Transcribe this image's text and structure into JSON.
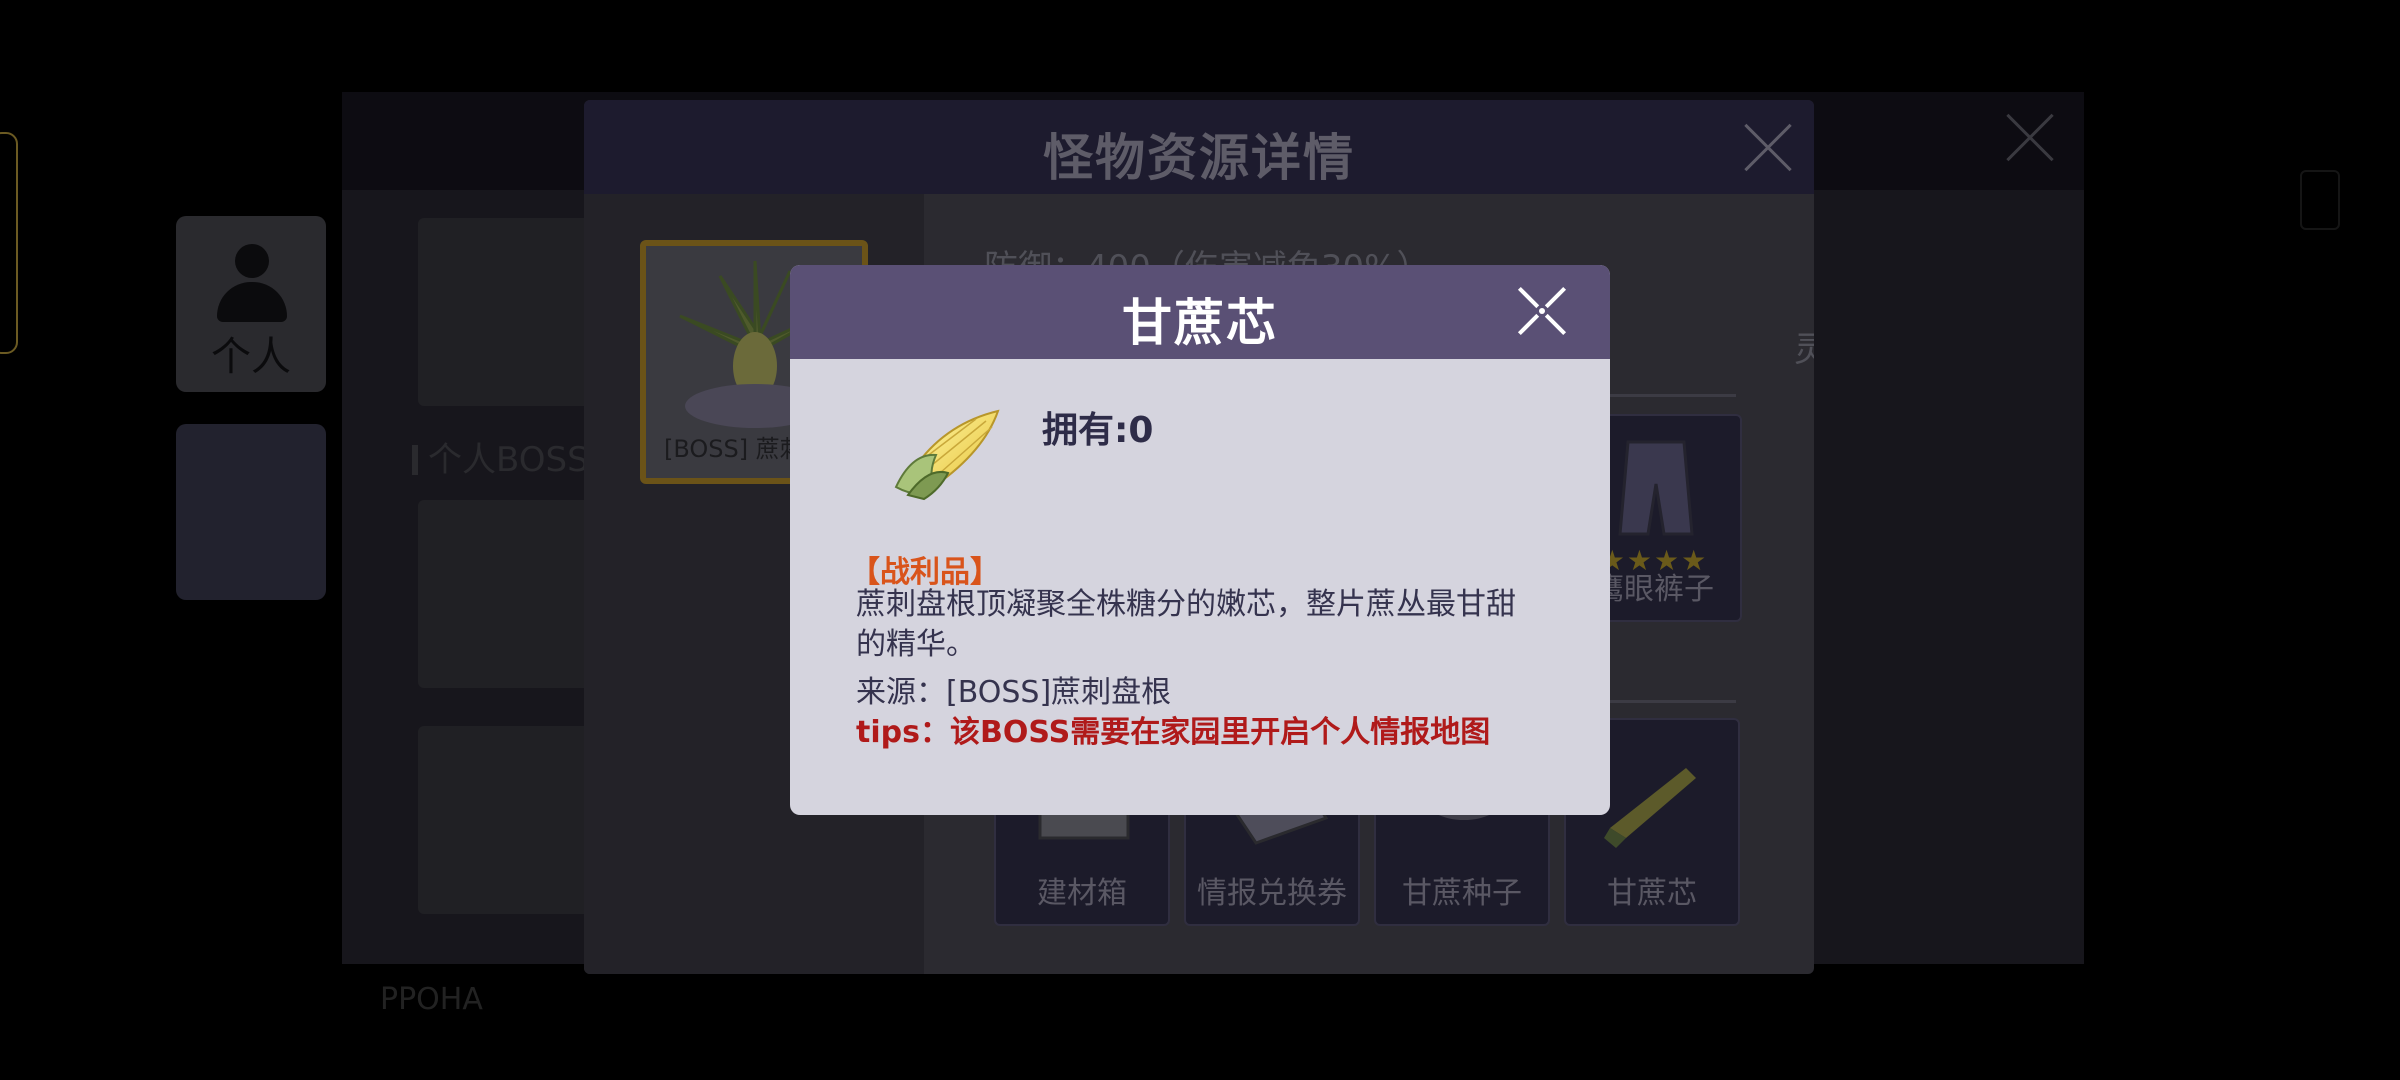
{
  "background": {
    "side_tabs": [
      {
        "label": "个人"
      },
      {
        "label": ""
      }
    ],
    "section_title": "个人BOSS",
    "footer_text": "PPOHA"
  },
  "monster_dialog": {
    "title": "怪物资源详情",
    "boss_card_label": "[BOSS] 蔗刺",
    "defense_stat": "防御：400（伤害减免30%）",
    "stat_right_fragment": "灵)",
    "loot_row1": [
      {
        "name": "鹰眼裤子",
        "stars": "★★★★",
        "icon": "pants-icon"
      }
    ],
    "loot_row2": [
      {
        "name": "建材箱",
        "icon": "crate-icon"
      },
      {
        "name": "情报兑换券",
        "icon": "voucher-icon"
      },
      {
        "name": "甘蔗种子",
        "icon": "seed-icon"
      },
      {
        "name": "甘蔗芯",
        "icon": "sugarcane-core-icon"
      }
    ]
  },
  "item_dialog": {
    "title": "甘蔗芯",
    "owned": "拥有:0",
    "tag": "【战利品】",
    "description": "蔗刺盘根顶凝聚全株糖分的嫩芯，整片蔗丛最甘甜的精华。",
    "source": "来源：[BOSS]蔗刺盘根",
    "tips": "tips：该BOSS需要在家园里开启个人情报地图",
    "icon": "sugarcane-core-icon"
  },
  "colors": {
    "header_purple": "#5a5075",
    "dialog_body": "#d5d4de",
    "tag_orange": "#d9541b",
    "tips_red": "#b01a1a",
    "text_dark": "#35334e"
  }
}
